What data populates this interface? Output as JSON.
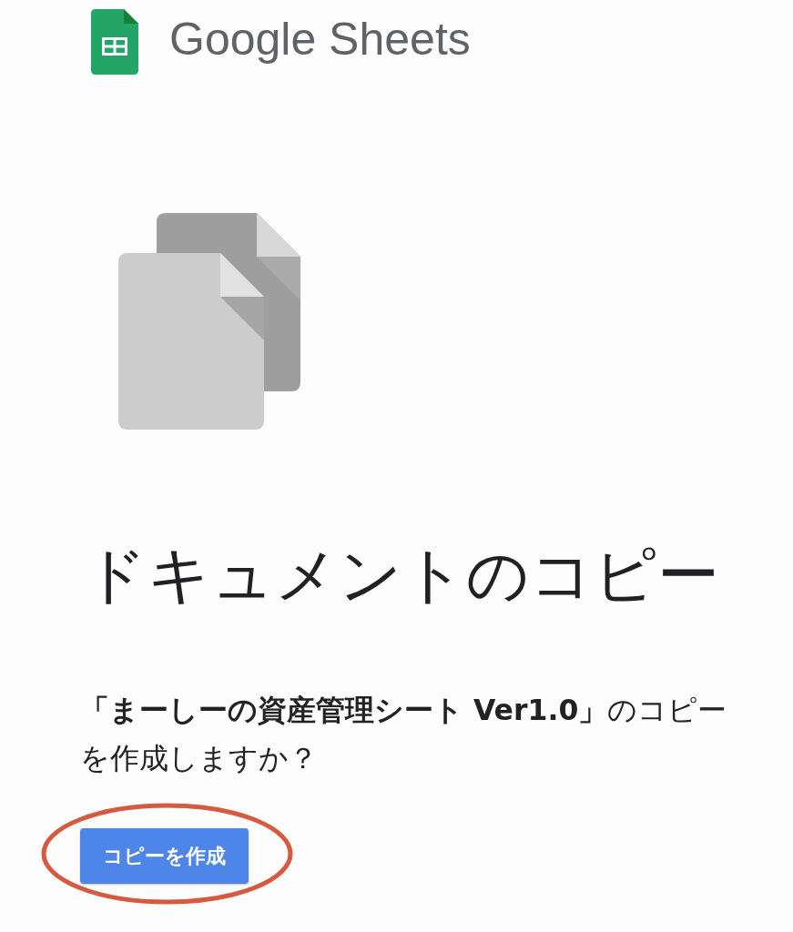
{
  "header": {
    "logo_text": "Google Sheets"
  },
  "title": "ドキュメントのコピー",
  "message": "**「まーしーの資産管理シート Ver1.0」**のコピーを作成しますか？",
  "button": {
    "label": "コピーを作成",
    "highlighted": true
  }
}
